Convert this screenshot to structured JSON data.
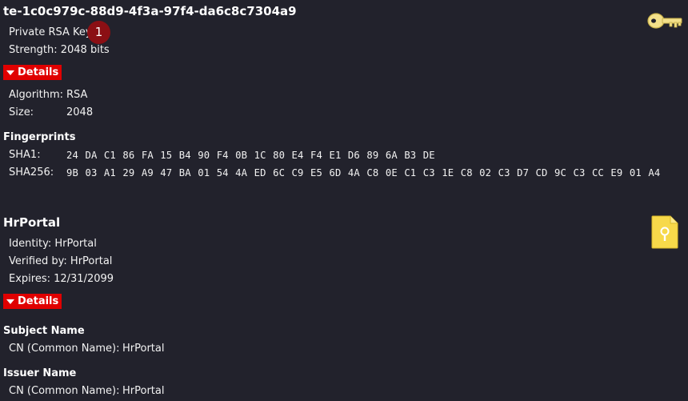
{
  "key": {
    "id": "te-1c0c979c-88d9-4f3a-97f4-da6c8c7304a9",
    "type": "Private RSA Key",
    "badge": "1",
    "strength": "Strength: 2048 bits",
    "icon": "key-icon"
  },
  "details_label": "Details",
  "key_details": {
    "algorithm_label": "Algorithm:",
    "algorithm_value": "RSA",
    "size_label": "Size:",
    "size_value": "2048"
  },
  "fingerprints": {
    "heading": "Fingerprints",
    "sha1_label": "SHA1:",
    "sha1_value": "24 DA C1 86 FA 15 B4 90 F4 0B 1C 80 E4 F4 E1 D6 89 6A B3 DE",
    "sha256_label": "SHA256:",
    "sha256_value": "9B 03 A1 29 A9 47 BA 01 54 4A ED 6C C9 E5 6D 4A C8 0E C1 C3 1E C8 02 C3 D7 CD 9C C3 CC E9 01 A4"
  },
  "certificate": {
    "name": "HrPortal",
    "identity": "Identity: HrPortal",
    "verified_by": "Verified by: HrPortal",
    "expires": "Expires: 12/31/2099",
    "icon": "certificate-icon"
  },
  "subject": {
    "heading": "Subject Name",
    "cn_label": "CN (Common Name):",
    "cn_value": "HrPortal"
  },
  "issuer": {
    "heading": "Issuer Name",
    "cn_label": "CN (Common Name):",
    "cn_value": "HrPortal"
  },
  "colors": {
    "background": "#22222c",
    "details_button": "#e00000",
    "badge": "#8b0f14",
    "key_icon": "#f3e08a",
    "certificate_icon": "#f7d94a"
  }
}
